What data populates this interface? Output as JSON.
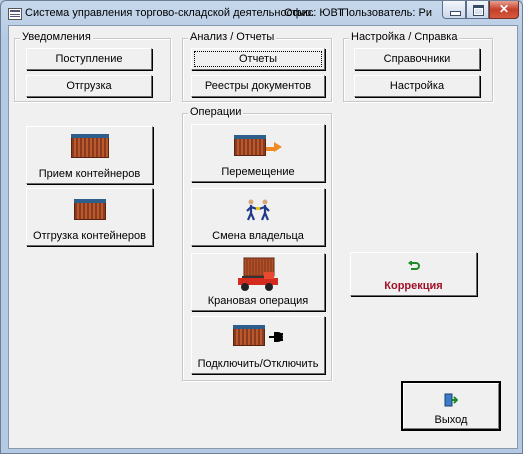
{
  "window": {
    "title": "Система  управления торгово-складской деятельностью.",
    "office": "Офис: ЮВТ",
    "user": "Пользователь: Ри"
  },
  "groups": {
    "notifications": {
      "title": "Уведомления",
      "items": [
        "Поступление",
        "Отгрузка"
      ]
    },
    "analysis": {
      "title": "Анализ / Отчеты",
      "items": [
        "Отчеты",
        "Реестры документов"
      ]
    },
    "settings": {
      "title": "Настройка / Справка",
      "items": [
        "Справочники",
        "Настройка"
      ]
    },
    "operations": {
      "title": "Операции",
      "items": [
        "Перемещение",
        "Смена владельца",
        "Крановая операция",
        "Подключить/Отключить"
      ]
    }
  },
  "buttons": {
    "receive": "Прием контейнеров",
    "ship": "Отгрузка контейнеров",
    "correction": "Коррекция",
    "exit": "Выход"
  },
  "icons": {
    "container": "shipping-container-icon",
    "move": "container-arrow-icon",
    "owner": "two-people-icon",
    "crane": "crane-truck-icon",
    "plug": "container-plug-icon",
    "correction": "undo-arrow-icon",
    "exit": "exit-door-icon"
  },
  "colors": {
    "correction_text": "#a0102a",
    "container": "#a34a25",
    "accent_arrow": "#f08a24"
  }
}
